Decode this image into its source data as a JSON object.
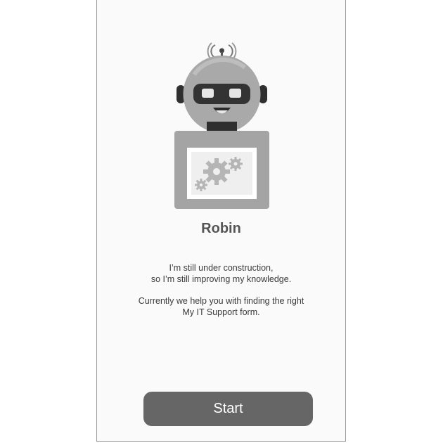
{
  "bot": {
    "name": "Robin"
  },
  "messages": {
    "status_line1": "I’m still under construction,",
    "status_line2": "so I’m still improving my knowledge.",
    "help_line1": "Currently we help you with finding the right",
    "help_line2": "My IT Support form."
  },
  "actions": {
    "start_label": "Start"
  },
  "colors": {
    "button_bg": "#666666",
    "button_text": "#ffffff",
    "title_text": "#555555"
  },
  "icons": {
    "mascot": "robot-mascot-icon",
    "gear": "gear-icon"
  }
}
